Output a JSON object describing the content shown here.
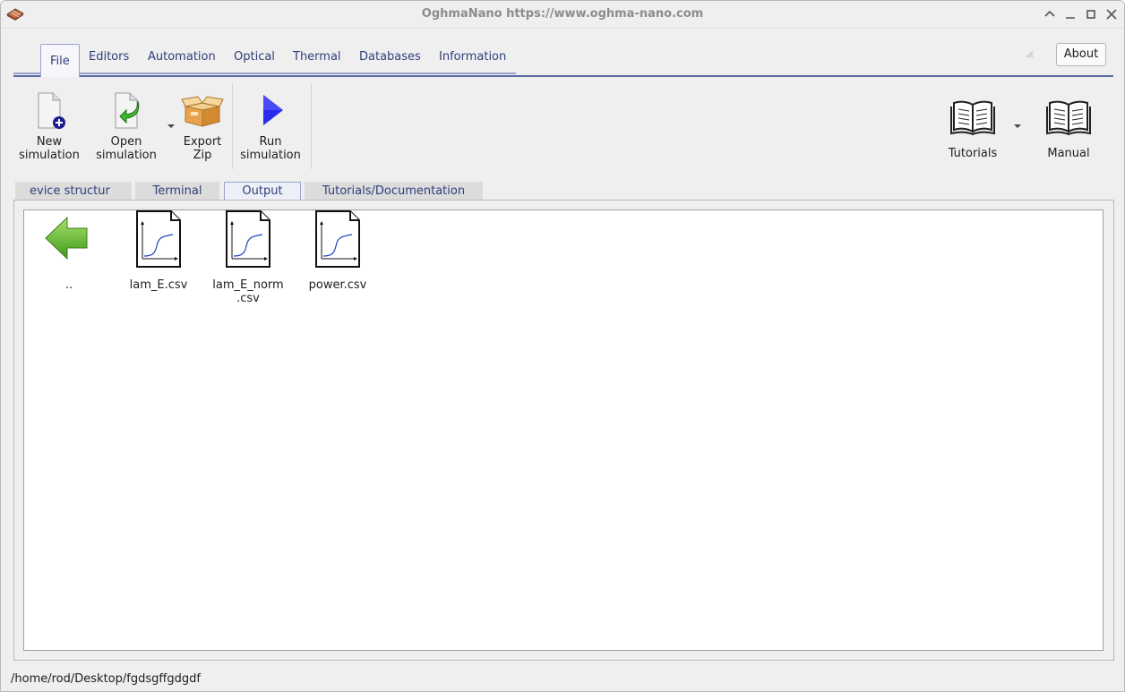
{
  "window": {
    "title": "OghmaNano https://www.oghma-nano.com"
  },
  "menu": {
    "tabs": [
      {
        "label": "File"
      },
      {
        "label": "Editors"
      },
      {
        "label": "Automation"
      },
      {
        "label": "Optical"
      },
      {
        "label": "Thermal"
      },
      {
        "label": "Databases"
      },
      {
        "label": "Information"
      }
    ],
    "active": "File",
    "about_label": "About"
  },
  "toolbar": {
    "new_simulation": {
      "line1": "New",
      "line2": "simulation",
      "icon": "new-file-icon"
    },
    "open_simulation": {
      "line1": "Open",
      "line2": "simulation",
      "icon": "open-file-icon"
    },
    "export_zip": {
      "line1": "Export",
      "line2": "Zip",
      "icon": "box-icon"
    },
    "run_simulation": {
      "line1": "Run",
      "line2": "simulation",
      "icon": "play-icon"
    },
    "tutorials": {
      "label": "Tutorials",
      "icon": "book-icon"
    },
    "manual": {
      "label": "Manual",
      "icon": "book-icon"
    }
  },
  "subtabs": [
    {
      "label": "evice structur"
    },
    {
      "label": "Terminal"
    },
    {
      "label": "Output"
    },
    {
      "label": "Tutorials/Documentation"
    }
  ],
  "subtab_active": "Output",
  "files": [
    {
      "name": "..",
      "icon": "back-arrow-icon"
    },
    {
      "name": "lam_E.csv",
      "icon": "graph-file-icon"
    },
    {
      "name": "lam_E_norm.csv",
      "line1": "lam_E_norm",
      "line2": ".csv",
      "icon": "graph-file-icon"
    },
    {
      "name": "power.csv",
      "icon": "graph-file-icon"
    }
  ],
  "status": {
    "path": "/home/rod/Desktop/fgdsgffgdgdf"
  },
  "colors": {
    "accent": "#5b6aa3",
    "tab_text": "#2f3f7a",
    "play": "#2b2bef",
    "arrow": "#5fbf2a"
  }
}
